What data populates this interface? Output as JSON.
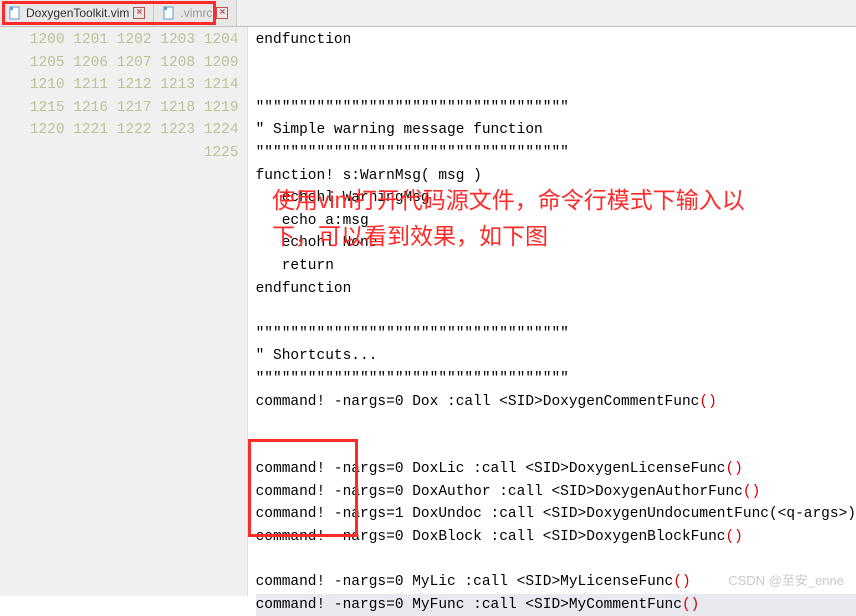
{
  "tabs": [
    {
      "label": "DoxygenToolkit.vim",
      "icon": "file"
    },
    {
      "label": ".vimrc",
      "icon": "file"
    }
  ],
  "gutter_start": 1200,
  "gutter_end": 1225,
  "code_lines": [
    "endfunction",
    "",
    "",
    "\"\"\"\"\"\"\"\"\"\"\"\"\"\"\"\"\"\"\"\"\"\"\"\"\"\"\"\"\"\"\"\"\"\"\"\"",
    "\" Simple warning message function",
    "\"\"\"\"\"\"\"\"\"\"\"\"\"\"\"\"\"\"\"\"\"\"\"\"\"\"\"\"\"\"\"\"\"\"\"\"",
    "function! s:WarnMsg( msg )",
    "   echohl WarningMsg",
    "   echo a:msg",
    "   echohl None",
    "   return",
    "endfunction",
    "",
    "\"\"\"\"\"\"\"\"\"\"\"\"\"\"\"\"\"\"\"\"\"\"\"\"\"\"\"\"\"\"\"\"\"\"\"\"",
    "\" Shortcuts...",
    "\"\"\"\"\"\"\"\"\"\"\"\"\"\"\"\"\"\"\"\"\"\"\"\"\"\"\"\"\"\"\"\"\"\"\"\"",
    "command! -nargs=0 Dox :call <SID>DoxygenCommentFunc()",
    "",
    "",
    "command! -nargs=0 DoxLic :call <SID>DoxygenLicenseFunc()",
    "command! -nargs=0 DoxAuthor :call <SID>DoxygenAuthorFunc()",
    "command! -nargs=1 DoxUndoc :call <SID>DoxygenUndocumentFunc(<q-args>)",
    "command! -nargs=0 DoxBlock :call <SID>DoxygenBlockFunc()",
    "",
    "command! -nargs=0 MyLic :call <SID>MyLicenseFunc()",
    "command! -nargs=0 MyFunc :call <SID>MyCommentFunc()"
  ],
  "highlight_line": 1225,
  "annotation": "使用vim打开代码源文件，命令行模式下输入以下，可以看到效果，如下图",
  "watermark": "CSDN @至安_enne"
}
